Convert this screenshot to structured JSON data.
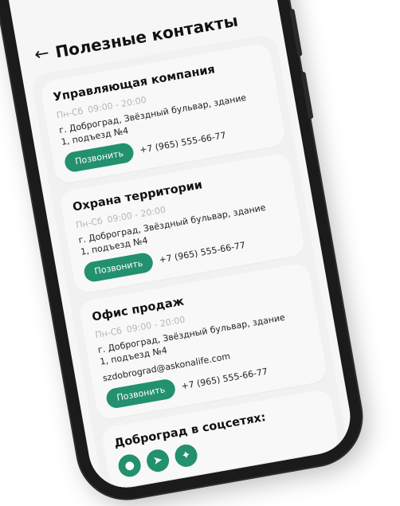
{
  "header": {
    "back_icon": "arrow-left-icon",
    "title": "Полезные контакты"
  },
  "contacts": [
    {
      "title": "Управляющая компания",
      "hours_days": "Пн-Сб",
      "hours_time": "09:00 - 20:00",
      "address": "г. Доброград, Звёздный бульвар, здание 1, подъезд №4",
      "call_label": "Позвонить",
      "phone": "+7 (965) 555-66-77"
    },
    {
      "title": "Охрана территории",
      "hours_days": "Пн-Сб",
      "hours_time": "09:00 - 20:00",
      "address": "г. Доброград, Звёздный бульвар, здание 1, подъезд №4",
      "call_label": "Позвонить",
      "phone": "+7 (965) 555-66-77"
    },
    {
      "title": "Офис продаж",
      "hours_days": "Пн-Сб",
      "hours_time": "09:00 - 20:00",
      "address": "г. Доброград, Звёздный бульвар, здание 1, подъезд №4",
      "email": "szdobrograd@askonalife.com",
      "call_label": "Позвонить",
      "phone": "+7 (965) 555-66-77"
    }
  ],
  "social": {
    "title": "Доброград в соцсетях:",
    "icons": [
      "vk-icon",
      "telegram-icon",
      "sparkle-icon"
    ]
  },
  "colors": {
    "accent": "#23906f",
    "card_bg": "#f7f8f7",
    "muted_text": "#b4b7b4"
  }
}
